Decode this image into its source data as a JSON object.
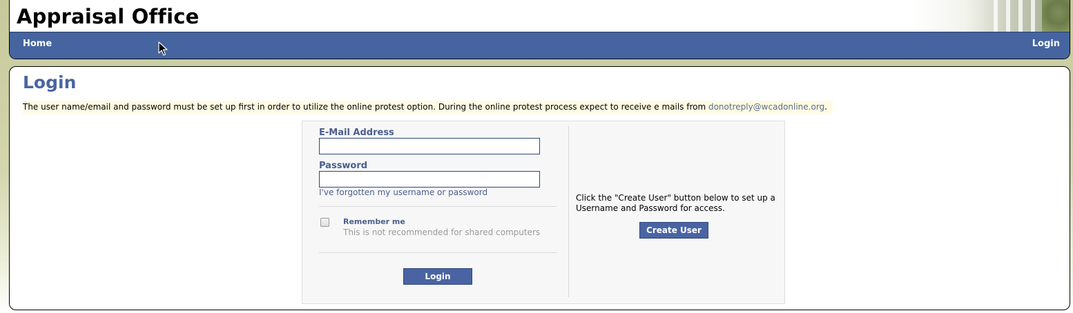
{
  "header": {
    "site_title": "Appraisal Office"
  },
  "nav": {
    "home_label": "Home",
    "login_label": "Login"
  },
  "main": {
    "page_title": "Login",
    "notice_text": "The user name/email and password must be set up first in order to utilize the online protest option.  During the online protest process expect to receive e mails from ",
    "notice_email": "donotreply@wcadonline.org",
    "notice_suffix": "."
  },
  "login_form": {
    "email_label": "E-Mail Address",
    "email_value": "",
    "password_label": "Password",
    "password_value": "",
    "forgot_link": "I've forgotten my username or password",
    "remember_label": "Remember me",
    "remember_checked": false,
    "remember_hint": "This is not recommended for shared computers",
    "login_button": "Login"
  },
  "create_user": {
    "instructions": "Click the \"Create User\" button below to set up a Username and Password for access.",
    "button": "Create User"
  },
  "colors": {
    "nav_bg": "#4564a0",
    "title_blue": "#4a65a0",
    "label_blue": "#4a5f8c",
    "button_bg": "#4a64a3",
    "notice_bg": "#fffbe3"
  }
}
